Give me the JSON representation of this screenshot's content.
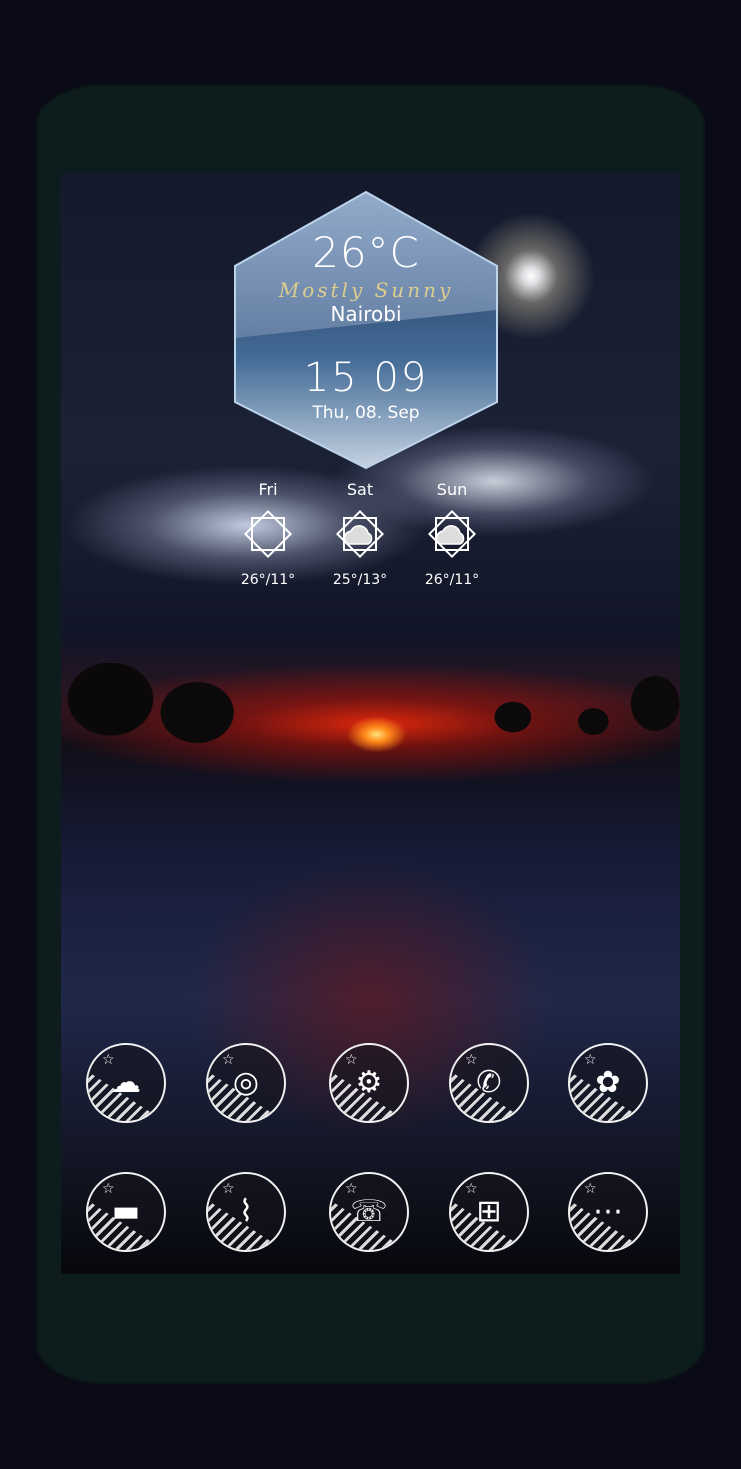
{
  "weather": {
    "temperature": "26°C",
    "condition": "Mostly Sunny",
    "city": "Nairobi",
    "time": "15 09",
    "date": "Thu, 08. Sep"
  },
  "forecast": [
    {
      "day": "Fri",
      "range": "26°/11°",
      "icon": "sunny-icon"
    },
    {
      "day": "Sat",
      "range": "25°/13°",
      "icon": "partly-cloudy-icon"
    },
    {
      "day": "Sun",
      "range": "26°/11°",
      "icon": "partly-cloudy-icon"
    }
  ],
  "apps_row1": [
    {
      "icon": "weather-cloud-icon",
      "glyph": "☁"
    },
    {
      "icon": "camera-icon",
      "glyph": "◎"
    },
    {
      "icon": "settings-gears-icon",
      "glyph": "⚙"
    },
    {
      "icon": "phone-chat-icon",
      "glyph": "✆"
    },
    {
      "icon": "flower-gallery-icon",
      "glyph": "✿"
    }
  ],
  "apps_row2": [
    {
      "icon": "file-manager-icon",
      "glyph": "▬"
    },
    {
      "icon": "cleaner-broom-icon",
      "glyph": "⌇"
    },
    {
      "icon": "dialer-phone-icon",
      "glyph": "☏"
    },
    {
      "icon": "app-drawer-grid-icon",
      "glyph": "⊞"
    },
    {
      "icon": "messages-icon",
      "glyph": "⋯"
    }
  ],
  "colors": {
    "phone_frame": "#0d1c1c",
    "background": "#0a0b16",
    "condition_text": "#e9d58a",
    "icon_ring": "#f2f2f2"
  }
}
